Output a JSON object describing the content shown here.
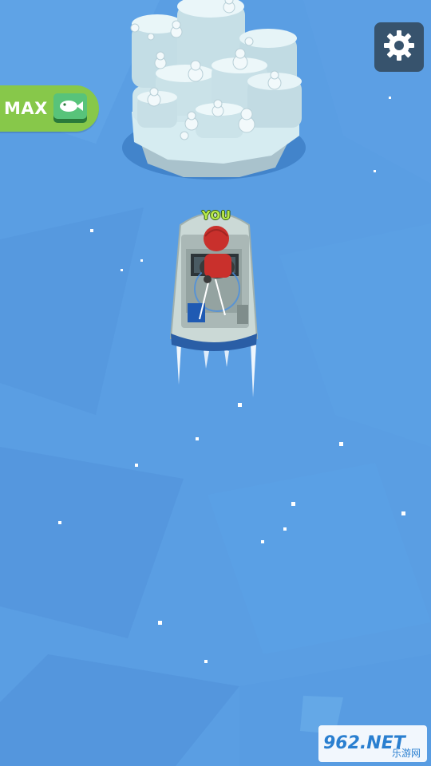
{
  "hud": {
    "max_label": "MAX",
    "fish_icon": "fish-icon",
    "settings_icon": "gear-icon"
  },
  "player": {
    "label": "YOU"
  },
  "watermark": {
    "main": "962.NET",
    "sub": "乐游网"
  },
  "colors": {
    "water": "#5a9ee3",
    "hud_green": "#87c84a",
    "settings_bg": "#37536d",
    "you_label": "#b8e84a",
    "ice": "#d9eef2",
    "boat_hull": "#c9d8d5"
  }
}
